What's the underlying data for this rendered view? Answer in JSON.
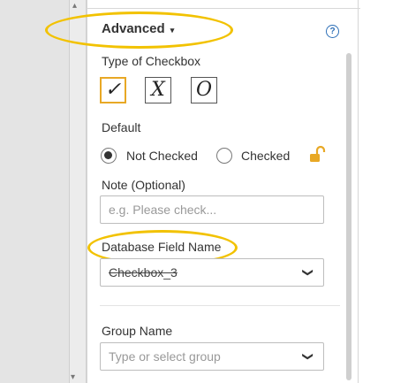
{
  "advanced": {
    "label": "Advanced",
    "caret": "▾",
    "help": "?"
  },
  "checkbox_type": {
    "label": "Type of Checkbox",
    "options": [
      {
        "glyph": "✓",
        "selected": true
      },
      {
        "glyph": "X",
        "selected": false
      },
      {
        "glyph": "O",
        "selected": false
      }
    ]
  },
  "default": {
    "label": "Default",
    "options": [
      {
        "label": "Not Checked",
        "checked": true
      },
      {
        "label": "Checked",
        "checked": false
      }
    ]
  },
  "note": {
    "label": "Note (Optional)",
    "placeholder": "e.g. Please check..."
  },
  "db_field": {
    "label": "Database Field Name",
    "value": "Checkbox_3"
  },
  "group": {
    "label": "Group Name",
    "placeholder": "Type or select group"
  },
  "colors": {
    "highlight": "#f2c200",
    "selected_border": "#e8a825",
    "accent": "#2d6fb7",
    "lock": "#e8a825"
  },
  "icons": [
    "caret-down-icon",
    "help-icon",
    "lock-open-icon",
    "chevron-down-icon"
  ]
}
